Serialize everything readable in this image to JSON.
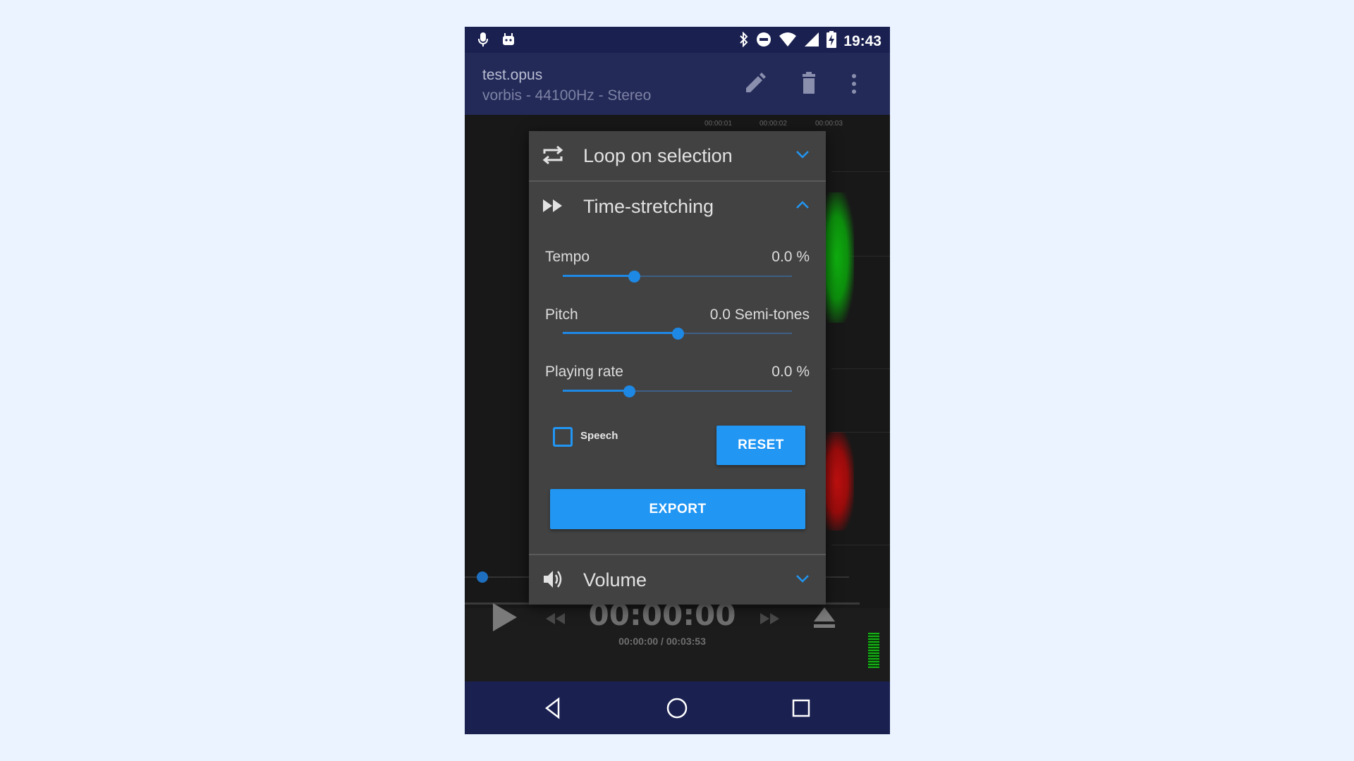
{
  "status_bar": {
    "time": "19:43",
    "left_icons": [
      "microphone-icon",
      "android-icon"
    ],
    "right_icons": [
      "bluetooth-icon",
      "do-not-disturb-icon",
      "wifi-icon",
      "cellular-signal-icon",
      "battery-charging-icon"
    ]
  },
  "toolbar": {
    "file_name": "test.opus",
    "file_info": "vorbis - 44100Hz - Stereo",
    "actions": [
      "edit-icon",
      "delete-icon",
      "more-options-icon"
    ]
  },
  "waveform": {
    "ruler_labels": [
      "00:00:01",
      "00:00:02",
      "00:00:03"
    ],
    "colors": {
      "left_channel": "#10b010",
      "right_channel": "#c01010"
    }
  },
  "dialog": {
    "loop_section": {
      "title": "Loop on selection",
      "expanded": false
    },
    "stretch_section": {
      "title": "Time-stretching",
      "expanded": true,
      "params": [
        {
          "label": "Tempo",
          "value": "0.0 %",
          "slider_fraction": 0.31
        },
        {
          "label": "Pitch",
          "value": "0.0 Semi-tones",
          "slider_fraction": 0.5
        },
        {
          "label": "Playing rate",
          "value": "0.0 %",
          "slider_fraction": 0.29
        }
      ],
      "speech_label": "Speech",
      "speech_checked": false,
      "reset_label": "RESET",
      "export_label": "EXPORT"
    },
    "volume_section": {
      "title": "Volume",
      "expanded": false
    }
  },
  "transport": {
    "time_main": "00:00:00",
    "time_sub": "00:00:00 / 00:03:53"
  },
  "colors": {
    "accent": "#2196f3",
    "status_bar": "#1a2150",
    "toolbar": "#232a58",
    "dialog_bg": "#424242"
  }
}
